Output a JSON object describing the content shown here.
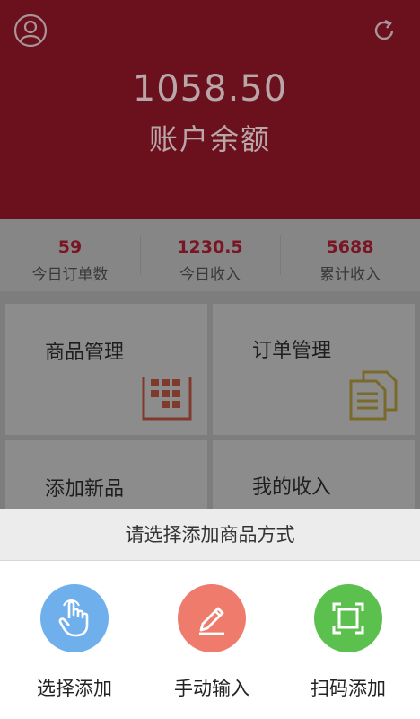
{
  "header": {
    "balance": "1058.50",
    "balance_label": "账户余额"
  },
  "stats": [
    {
      "value": "59",
      "label": "今日订单数"
    },
    {
      "value": "1230.5",
      "label": "今日收入"
    },
    {
      "value": "5688",
      "label": "累计收入"
    }
  ],
  "grid": {
    "product_mgmt": "商品管理",
    "order_mgmt": "订单管理",
    "add_product": "添加新品",
    "my_income": "我的收入"
  },
  "sheet": {
    "title": "请选择添加商品方式",
    "options": [
      {
        "label": "选择添加",
        "icon": "hand-pointer-icon",
        "color": "#6fb0ec"
      },
      {
        "label": "手动输入",
        "icon": "pencil-icon",
        "color": "#ee7b6c"
      },
      {
        "label": "扫码添加",
        "icon": "scan-frame-icon",
        "color": "#5cc04f"
      }
    ]
  },
  "colors": {
    "header_bg": "#6b111d",
    "accent": "#7a1524"
  }
}
